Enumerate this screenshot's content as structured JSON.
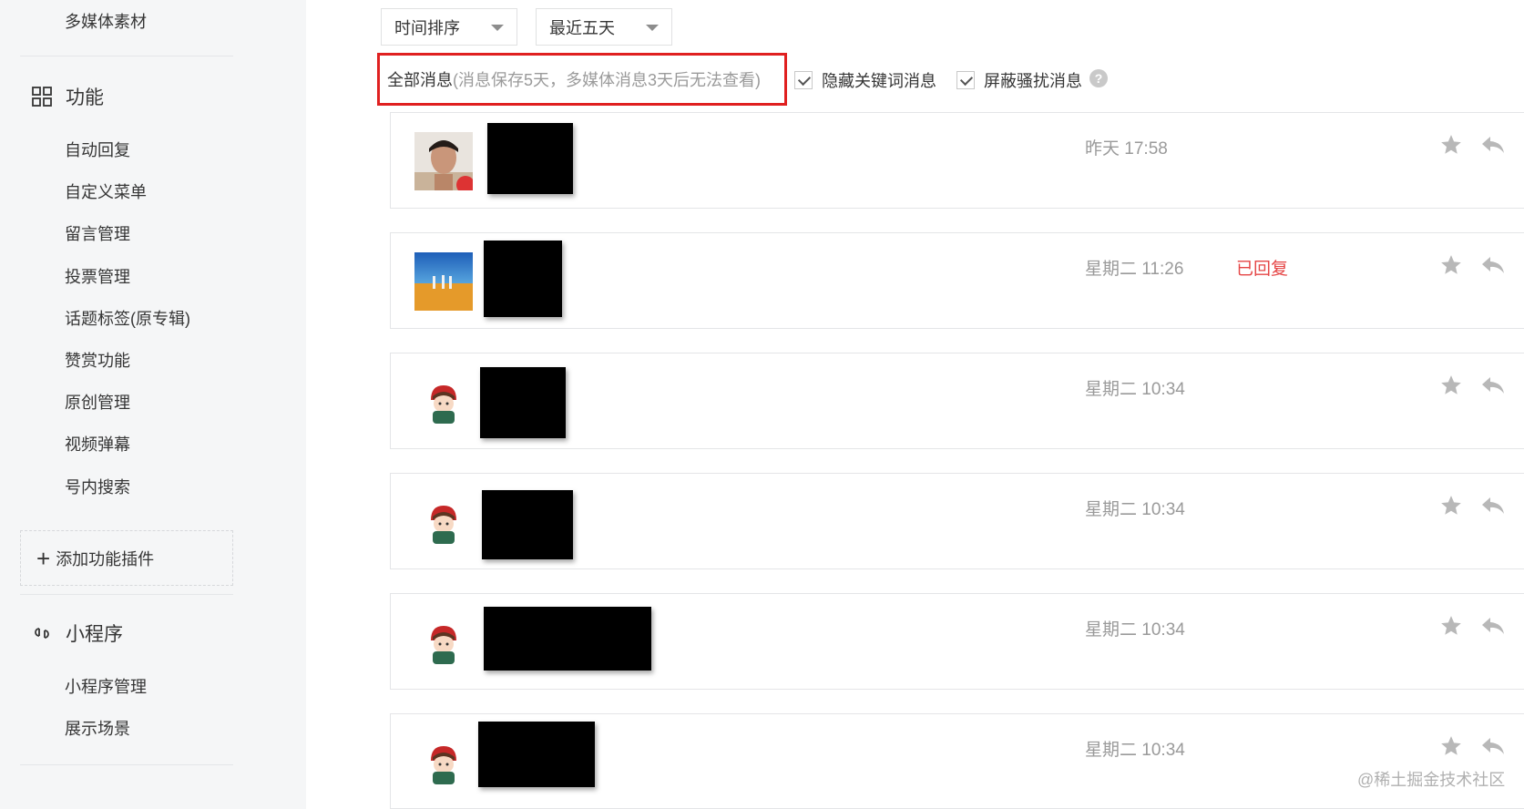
{
  "sidebar": {
    "top_item": "多媒体素材",
    "features_section": {
      "title": "功能",
      "icon": "grid-icon"
    },
    "feature_items": [
      "自动回复",
      "自定义菜单",
      "留言管理",
      "投票管理",
      "话题标签(原专辑)",
      "赞赏功能",
      "原创管理",
      "视频弹幕",
      "号内搜索"
    ],
    "add_plugin": "添加功能插件",
    "miniprogram_section": {
      "title": "小程序",
      "icon": "link-icon"
    },
    "miniprogram_items": [
      "小程序管理",
      "展示场景"
    ]
  },
  "toolbar": {
    "sort_select": "时间排序",
    "range_select": "最近五天"
  },
  "filters": {
    "all_messages": "全部消息",
    "all_messages_note": "(消息保存5天，多媒体消息3天后无法查看)",
    "hide_keyword_label": "隐藏关键词消息",
    "hide_keyword_checked": true,
    "block_spam_label": "屏蔽骚扰消息",
    "block_spam_checked": true,
    "help_icon": "question-icon"
  },
  "messages": [
    {
      "time": "昨天 17:58",
      "status": "",
      "avatar": "portrait-avatar"
    },
    {
      "time": "星期二 11:26",
      "status": "已回复",
      "avatar": "desert-avatar"
    },
    {
      "time": "星期二 10:34",
      "status": "",
      "avatar": "cartoon-avatar"
    },
    {
      "time": "星期二 10:34",
      "status": "",
      "avatar": "cartoon-avatar"
    },
    {
      "time": "星期二 10:34",
      "status": "",
      "avatar": "cartoon-avatar"
    },
    {
      "time": "星期二 10:34",
      "status": "",
      "avatar": "cartoon-avatar"
    }
  ],
  "watermark": "@稀土掘金技术社区",
  "colors": {
    "sidebar_bg": "#f5f6f7",
    "highlight_border": "#e02020",
    "replied_text": "#e54545",
    "muted_text": "#9a9a9a"
  }
}
